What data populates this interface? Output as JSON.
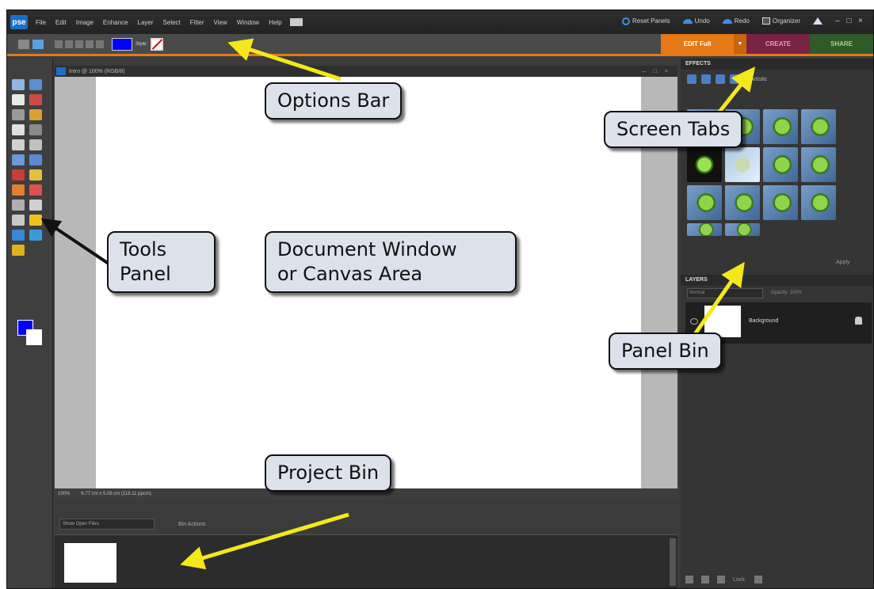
{
  "app": {
    "logo": "pse",
    "menu": [
      "File",
      "Edit",
      "Image",
      "Enhance",
      "Layer",
      "Select",
      "Filter",
      "View",
      "Window",
      "Help"
    ],
    "right_buttons": [
      "Reset Panels",
      "Undo",
      "Redo",
      "Organizer"
    ],
    "window_controls": "– □ ×"
  },
  "options_bar": {
    "style_label": "Style:",
    "tabs": {
      "edit": "EDIT Full",
      "create": "CREATE",
      "share": "SHARE"
    }
  },
  "document": {
    "title": "Intro @ 100% (RGB/8)",
    "window_controls": "– □ ×",
    "zoom": "100%",
    "size_info": "6.77 cm x 5.08 cm (118.11 ppcm)"
  },
  "project_bin": {
    "show_label": "Show Open Files",
    "bin_actions": "Bin Actions"
  },
  "panel_bin": {
    "effects_title": "EFFECTS",
    "effects_category": "Artistic",
    "apply": "Apply",
    "layers_title": "LAYERS",
    "blend_mode": "Normal",
    "opacity_label": "Opacity: 100%",
    "layer_name": "Background",
    "lock_label": "Lock:"
  },
  "callouts": {
    "options_bar": "Options Bar",
    "screen_tabs": "Screen Tabs",
    "tools_panel": "Tools\nPanel",
    "document_window": "Document Window\nor Canvas Area",
    "panel_bin": "Panel Bin",
    "project_bin": "Project Bin"
  },
  "colors": {
    "foreground": "#0000ff",
    "background": "#ffffff",
    "edit_tab": "#e57a14",
    "create_tab": "#7a2242",
    "share_tab": "#2f5a2a",
    "callout_fill": "#dce1ec",
    "arrow_yellow": "#f4e81a"
  }
}
